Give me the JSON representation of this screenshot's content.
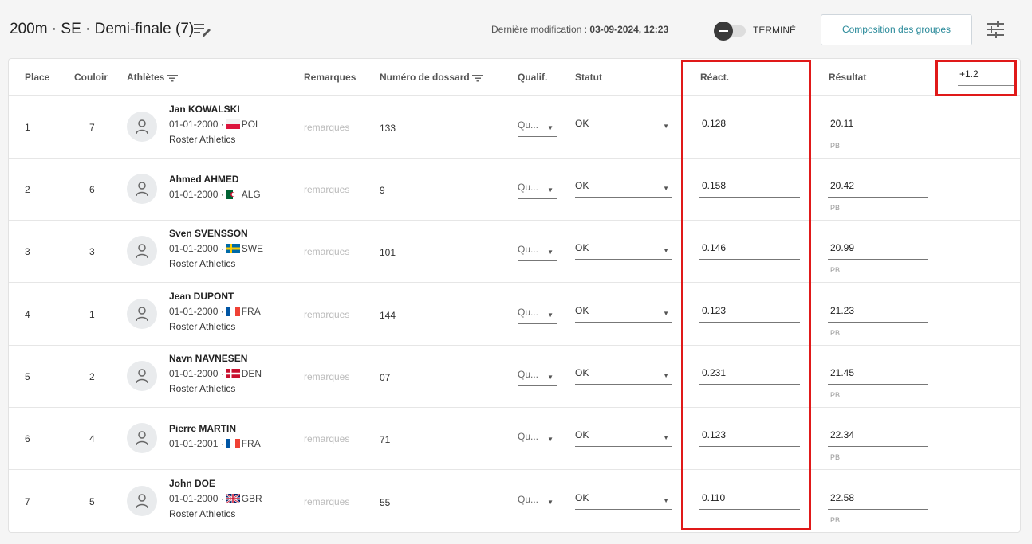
{
  "header": {
    "title": "200m · SE · Demi-finale (7)",
    "last_modified_label": "Dernière modification :",
    "last_modified_value": "03-09-2024, 12:23",
    "toggle_label": "TERMINÉ",
    "groups_button": "Composition des groupes"
  },
  "table": {
    "columns": {
      "place": "Place",
      "lane": "Couloir",
      "athletes": "Athlètes",
      "remarks": "Remarques",
      "bib": "Numéro de dossard",
      "qualif": "Qualif.",
      "status": "Statut",
      "reaction": "Réact.",
      "result": "Résultat"
    },
    "wind": "+1.2",
    "rows": [
      {
        "place": "1",
        "lane": "7",
        "name": "Jan KOWALSKI",
        "dob": "01-01-2000 ·",
        "country": "POL",
        "club": "Roster Athletics",
        "remarks": "remarques",
        "bib": "133",
        "qualif": "Qu...",
        "status": "OK",
        "reaction": "0.128",
        "result": "20.11",
        "pb": "PB"
      },
      {
        "place": "2",
        "lane": "6",
        "name": "Ahmed AHMED",
        "dob": "01-01-2000 ·",
        "country": "ALG",
        "club": "",
        "remarks": "remarques",
        "bib": "9",
        "qualif": "Qu...",
        "status": "OK",
        "reaction": "0.158",
        "result": "20.42",
        "pb": "PB"
      },
      {
        "place": "3",
        "lane": "3",
        "name": "Sven SVENSSON",
        "dob": "01-01-2000 ·",
        "country": "SWE",
        "club": "Roster Athletics",
        "remarks": "remarques",
        "bib": "101",
        "qualif": "Qu...",
        "status": "OK",
        "reaction": "0.146",
        "result": "20.99",
        "pb": "PB"
      },
      {
        "place": "4",
        "lane": "1",
        "name": "Jean DUPONT",
        "dob": "01-01-2000 ·",
        "country": "FRA",
        "club": "Roster Athletics",
        "remarks": "remarques",
        "bib": "144",
        "qualif": "Qu...",
        "status": "OK",
        "reaction": "0.123",
        "result": "21.23",
        "pb": "PB"
      },
      {
        "place": "5",
        "lane": "2",
        "name": "Navn NAVNESEN",
        "dob": "01-01-2000 ·",
        "country": "DEN",
        "club": "Roster Athletics",
        "remarks": "remarques",
        "bib": "07",
        "qualif": "Qu...",
        "status": "OK",
        "reaction": "0.231",
        "result": "21.45",
        "pb": "PB"
      },
      {
        "place": "6",
        "lane": "4",
        "name": "Pierre MARTIN",
        "dob": "01-01-2001 ·",
        "country": "FRA",
        "club": "",
        "remarks": "remarques",
        "bib": "71",
        "qualif": "Qu...",
        "status": "OK",
        "reaction": "0.123",
        "result": "22.34",
        "pb": "PB"
      },
      {
        "place": "7",
        "lane": "5",
        "name": "John DOE",
        "dob": "01-01-2000 ·",
        "country": "GBR",
        "club": "Roster Athletics",
        "remarks": "remarques",
        "bib": "55",
        "qualif": "Qu...",
        "status": "OK",
        "reaction": "0.110",
        "result": "22.58",
        "pb": "PB"
      }
    ]
  },
  "colors": {
    "accent": "#2a8a9a",
    "highlight": "#e01919"
  },
  "icons": {
    "title_icon": "edit-list-icon",
    "settings_icon": "tune-settings-icon",
    "filter_icon": "filter-icon",
    "avatar_icon": "person-icon"
  }
}
